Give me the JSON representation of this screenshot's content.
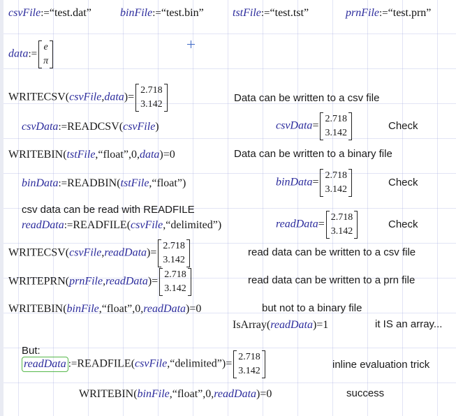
{
  "defs": {
    "csv_var": "csvFile",
    "csv_val": "“test.dat”",
    "bin_var": "binFile",
    "bin_val": "“test.bin”",
    "tst_var": "tstFile",
    "tst_val": "“test.tst”",
    "prn_var": "prnFile",
    "prn_val": "“test.prn”"
  },
  "data_def": {
    "var": "data",
    "cells": [
      "e",
      "π"
    ]
  },
  "result_cells": [
    "2.718",
    "3.142"
  ],
  "rows": {
    "r1": {
      "fn": "WRITECSV",
      "a1": "csvFile",
      "a2": "data",
      "note": "Data can be written to a csv file"
    },
    "r2": {
      "lhs": "csvData",
      "fn": "READCSV",
      "a1": "csvFile",
      "evar": "csvData",
      "note": "Check"
    },
    "r3": {
      "fn": "WRITEBIN",
      "a1": "tstFile",
      "a2": "“float”",
      "a3": "0",
      "a4": "data",
      "res": "0",
      "note": "Data can be written to a binary file"
    },
    "r4": {
      "lhs": "binData",
      "fn": "READBIN",
      "a1": "tstFile",
      "a2": "“float”",
      "evar": "binData",
      "note": "Check"
    },
    "r5": {
      "text": "csv data can be read with READFILE"
    },
    "r6": {
      "lhs": "readData",
      "fn": "READFILE",
      "a1": "csvFile",
      "a2": "“delimited”",
      "evar": "readData",
      "note": "Check"
    },
    "r7": {
      "fn": "WRITECSV",
      "a1": "csvFile",
      "a2": "readData",
      "note": "read data can be written to a csv file"
    },
    "r8": {
      "fn": "WRITEPRN",
      "a1": "prnFile",
      "a2": "readData",
      "note": "read data can be written to a prn file"
    },
    "r9": {
      "fn": "WRITEBIN",
      "a1": "binFile",
      "a2": "“float”",
      "a3": "0",
      "a4": "readData",
      "res": "0",
      "note": "but not to a binary file"
    },
    "r10": {
      "fn": "IsArray",
      "a1": "readData",
      "res": "1",
      "note": "it IS an array..."
    },
    "r11": {
      "text": "But:"
    },
    "r12": {
      "lhs": "readData",
      "fn": "READFILE",
      "a1": "csvFile",
      "a2": "“delimited”",
      "note": "inline evaluation trick"
    },
    "r13": {
      "fn": "WRITEBIN",
      "a1": "binFile",
      "a2": "“float”",
      "a3": "0",
      "a4": "readData",
      "res": "0",
      "note": "success"
    }
  },
  "symbols": {
    "assign": ":=",
    "eq": "=",
    "lp": "(",
    "rp": ")",
    "comma": ","
  }
}
